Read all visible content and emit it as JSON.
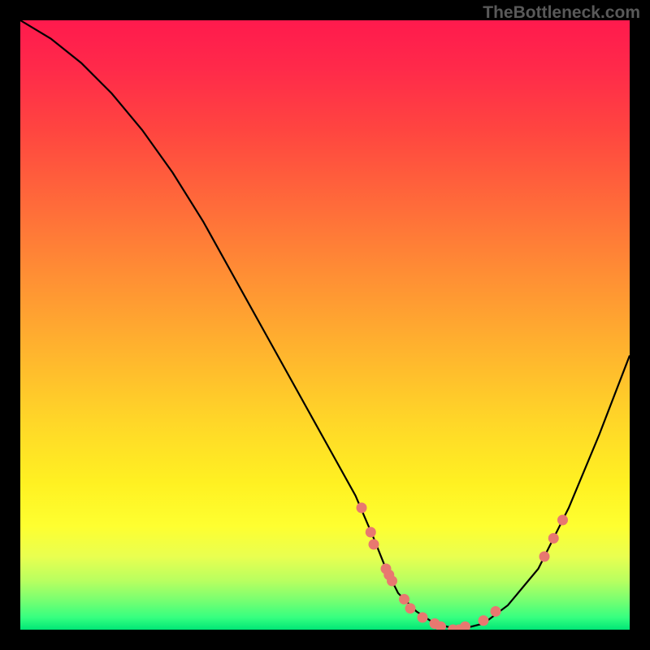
{
  "watermark": "TheBottleneck.com",
  "chart_data": {
    "type": "line",
    "title": "",
    "xlabel": "",
    "ylabel": "",
    "xlim": [
      0,
      100
    ],
    "ylim": [
      0,
      100
    ],
    "grid": false,
    "legend": false,
    "series": [
      {
        "name": "bottleneck-curve",
        "x": [
          0,
          5,
          10,
          15,
          20,
          25,
          30,
          35,
          40,
          45,
          50,
          55,
          58,
          60,
          62,
          65,
          68,
          72,
          76,
          80,
          85,
          90,
          95,
          100
        ],
        "y": [
          100,
          97,
          93,
          88,
          82,
          75,
          67,
          58,
          49,
          40,
          31,
          22,
          15,
          10,
          6,
          3,
          1,
          0,
          1,
          4,
          10,
          20,
          32,
          45
        ]
      }
    ],
    "scatter_points": {
      "name": "highlighted-points",
      "color": "#e87870",
      "points": [
        {
          "x": 56,
          "y": 20
        },
        {
          "x": 57.5,
          "y": 16
        },
        {
          "x": 58,
          "y": 14
        },
        {
          "x": 60,
          "y": 10
        },
        {
          "x": 60.5,
          "y": 9
        },
        {
          "x": 61,
          "y": 8
        },
        {
          "x": 63,
          "y": 5
        },
        {
          "x": 64,
          "y": 3.5
        },
        {
          "x": 66,
          "y": 2
        },
        {
          "x": 68,
          "y": 1
        },
        {
          "x": 69,
          "y": 0.5
        },
        {
          "x": 71,
          "y": 0
        },
        {
          "x": 72,
          "y": 0
        },
        {
          "x": 73,
          "y": 0.5
        },
        {
          "x": 76,
          "y": 1.5
        },
        {
          "x": 78,
          "y": 3
        },
        {
          "x": 86,
          "y": 12
        },
        {
          "x": 87.5,
          "y": 15
        },
        {
          "x": 89,
          "y": 18
        }
      ]
    },
    "background_gradient": {
      "top": "#ff1a4d",
      "middle": "#ffd728",
      "bottom": "#00e676"
    }
  }
}
